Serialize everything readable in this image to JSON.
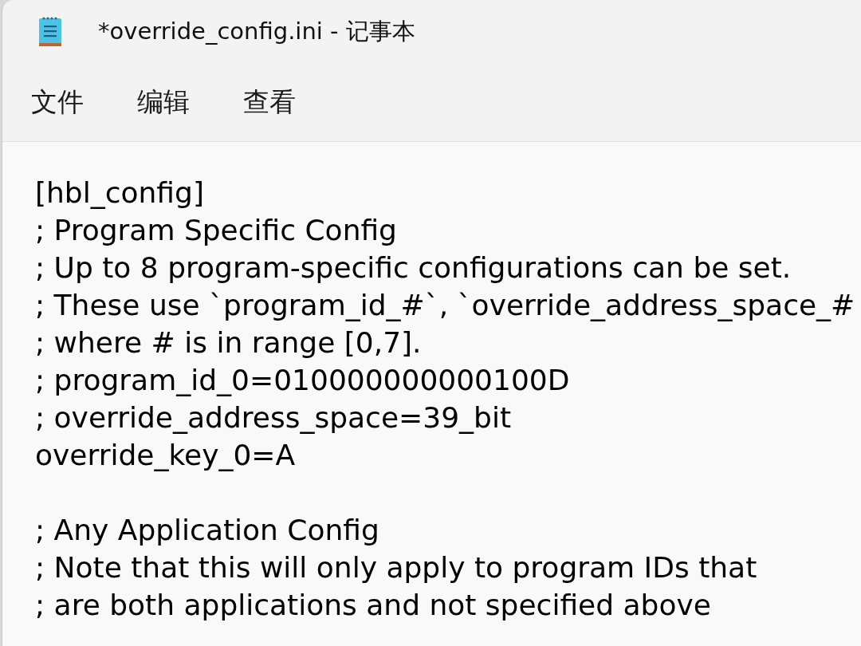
{
  "window": {
    "title": "*override_config.ini - 记事本"
  },
  "menu": [
    {
      "label": "文件"
    },
    {
      "label": "编辑"
    },
    {
      "label": "查看"
    }
  ],
  "editor": {
    "lines": [
      {
        "kind": "text",
        "text": "[hbl_config]"
      },
      {
        "kind": "text",
        "text": "; Program Specific Config"
      },
      {
        "kind": "text",
        "text": "; Up to 8 program-specific configurations can be set."
      },
      {
        "kind": "text",
        "text": "; These use `program_id_#`, `override_address_space_#"
      },
      {
        "kind": "text",
        "text": "; where # is in range [0,7]."
      },
      {
        "kind": "text",
        "text": "; program_id_0=010000000000100D"
      },
      {
        "kind": "text",
        "text": "; override_address_space=39_bit"
      },
      {
        "kind": "text",
        "text": "override_key_0=A"
      },
      {
        "kind": "blank"
      },
      {
        "kind": "text",
        "text": "; Any Application Config"
      },
      {
        "kind": "text",
        "text": "; Note that this will only apply to program IDs that"
      },
      {
        "kind": "text",
        "text": "; are both applications and not specified above"
      }
    ]
  }
}
